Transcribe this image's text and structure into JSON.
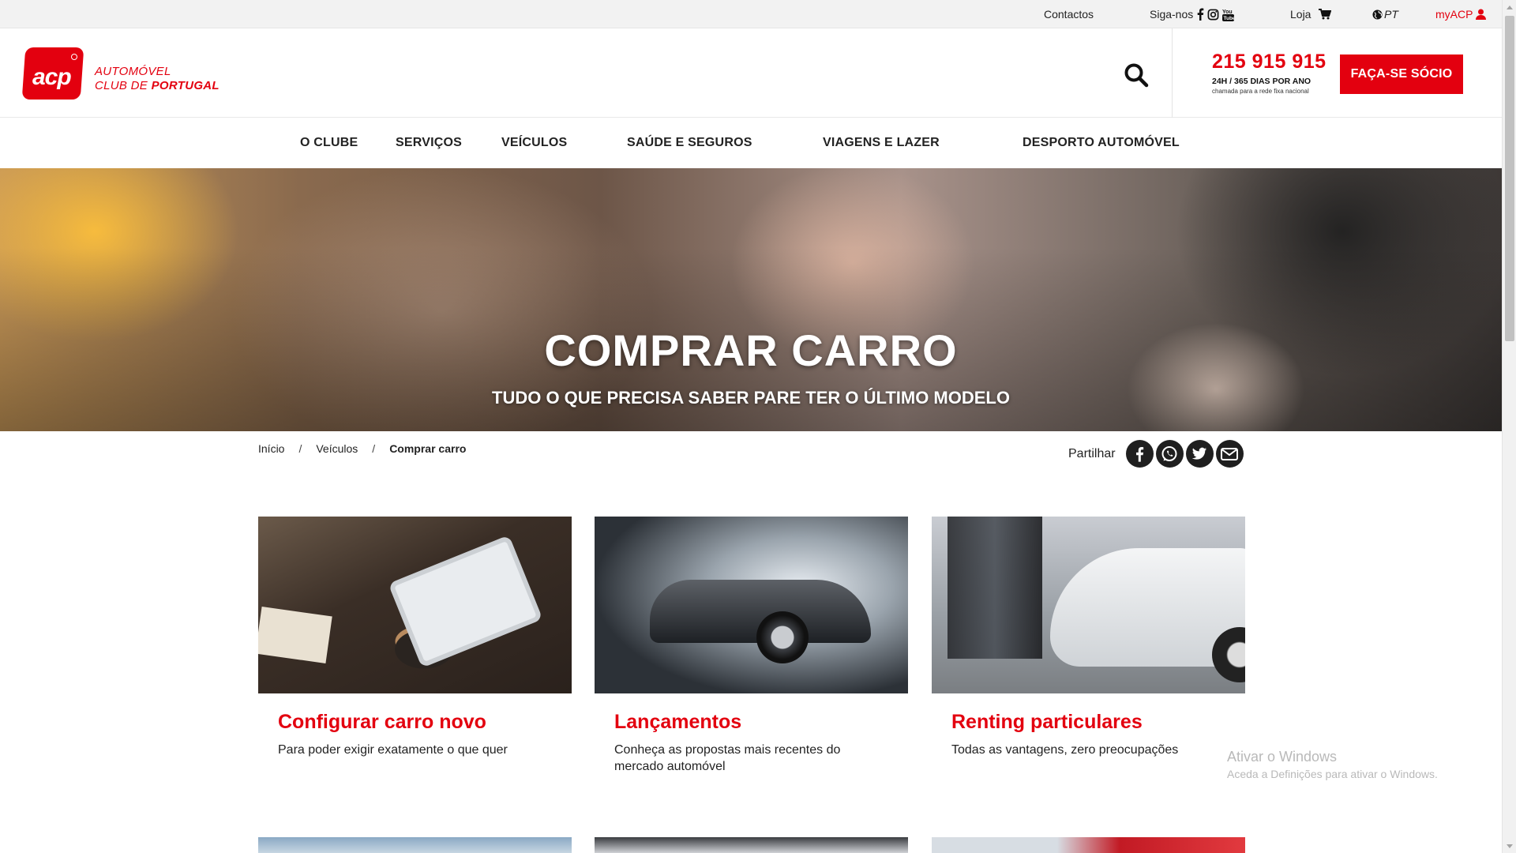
{
  "topbar": {
    "contacts": "Contactos",
    "follow": "Siga-nos",
    "store": "Loja",
    "language": "PT",
    "account": "myACP"
  },
  "header": {
    "logo_text": "acp",
    "brand_line1": "AUTOMÓVEL",
    "brand_line2a": "CLUB DE ",
    "brand_line2b": "PORTUGAL",
    "phone": "215 915 915",
    "phone_sub": "24H / 365 DIAS POR ANO",
    "phone_note": "chamada para a rede fixa nacional",
    "cta": "FAÇA-SE SÓCIO"
  },
  "nav": {
    "items": [
      "O CLUBE",
      "SERVIÇOS",
      "VEÍCULOS",
      "SAÚDE E SEGUROS",
      "VIAGENS E LAZER",
      "DESPORTO AUTOMÓVEL"
    ]
  },
  "hero": {
    "title": "COMPRAR CARRO",
    "subtitle": "TUDO O QUE PRECISA SABER PARE TER O ÚLTIMO MODELO"
  },
  "breadcrumb": {
    "items": [
      "Início",
      "Veículos",
      "Comprar carro"
    ],
    "separator": "/"
  },
  "share": {
    "label": "Partilhar",
    "networks": [
      "facebook-icon",
      "whatsapp-icon",
      "twitter-icon",
      "email-icon"
    ]
  },
  "cards": [
    {
      "title": "Configurar carro novo",
      "description": "Para poder exigir exatamente o que quer"
    },
    {
      "title": "Lançamentos",
      "description": "Conheça as propostas mais recentes do mercado automóvel"
    },
    {
      "title": "Renting particulares",
      "description": "Todas as vantagens, zero preocupações"
    }
  ],
  "watermark": {
    "title": "Ativar o Windows",
    "subtitle": "Aceda a Definições para ativar o Windows."
  },
  "colors": {
    "brand_red": "#e3000f",
    "topbar_bg": "#f2f2f2",
    "text_dark": "#222222"
  }
}
